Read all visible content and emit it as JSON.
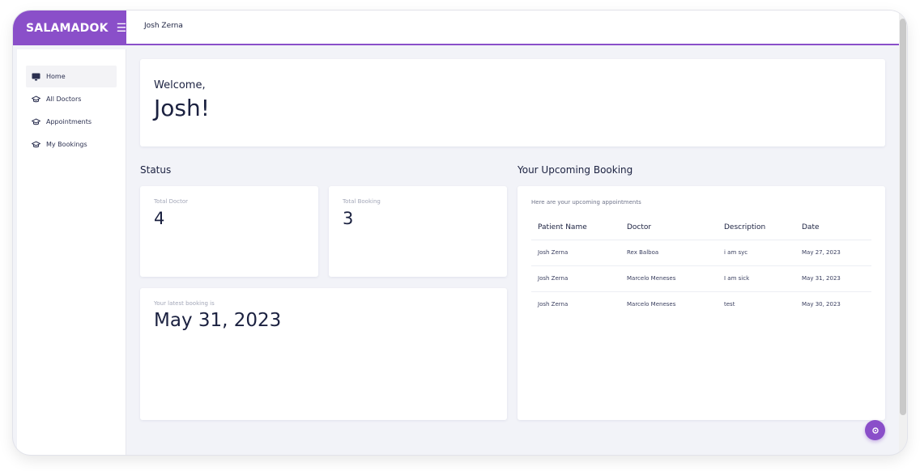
{
  "app": {
    "brand": "SALAMADOK",
    "menu_icon": "hamburger-icon"
  },
  "topbar": {
    "user_name": "Josh Zerna"
  },
  "sidebar": {
    "items": [
      {
        "label": "Home",
        "icon": "monitor-icon",
        "active": true
      },
      {
        "label": "All Doctors",
        "icon": "graduation-cap-icon",
        "active": false
      },
      {
        "label": "Appointments",
        "icon": "graduation-cap-icon",
        "active": false
      },
      {
        "label": "My Bookings",
        "icon": "graduation-cap-icon",
        "active": false
      }
    ]
  },
  "welcome": {
    "greeting": "Welcome,",
    "name": "Josh!"
  },
  "status": {
    "title": "Status",
    "total_doctor_label": "Total Doctor",
    "total_doctor_value": "4",
    "total_booking_label": "Total Booking",
    "total_booking_value": "3",
    "latest_label": "Your latest booking is",
    "latest_date": "May 31, 2023"
  },
  "upcoming": {
    "title": "Your Upcoming Booking",
    "intro": "Here are your upcoming appointments",
    "columns": [
      "Patient Name",
      "Doctor",
      "Description",
      "Date"
    ],
    "rows": [
      [
        "Josh Zerna",
        "Rex Balboa",
        "i am syc",
        "May 27, 2023"
      ],
      [
        "Josh Zerna",
        "Marcelo Meneses",
        "I am sick",
        "May 31, 2023"
      ],
      [
        "Josh Zerna",
        "Marcelo Meneses",
        "test",
        "May 30, 2023"
      ]
    ]
  },
  "colors": {
    "accent": "#8a4fc9",
    "background": "#f2f3f8",
    "text": "#1b2140"
  }
}
